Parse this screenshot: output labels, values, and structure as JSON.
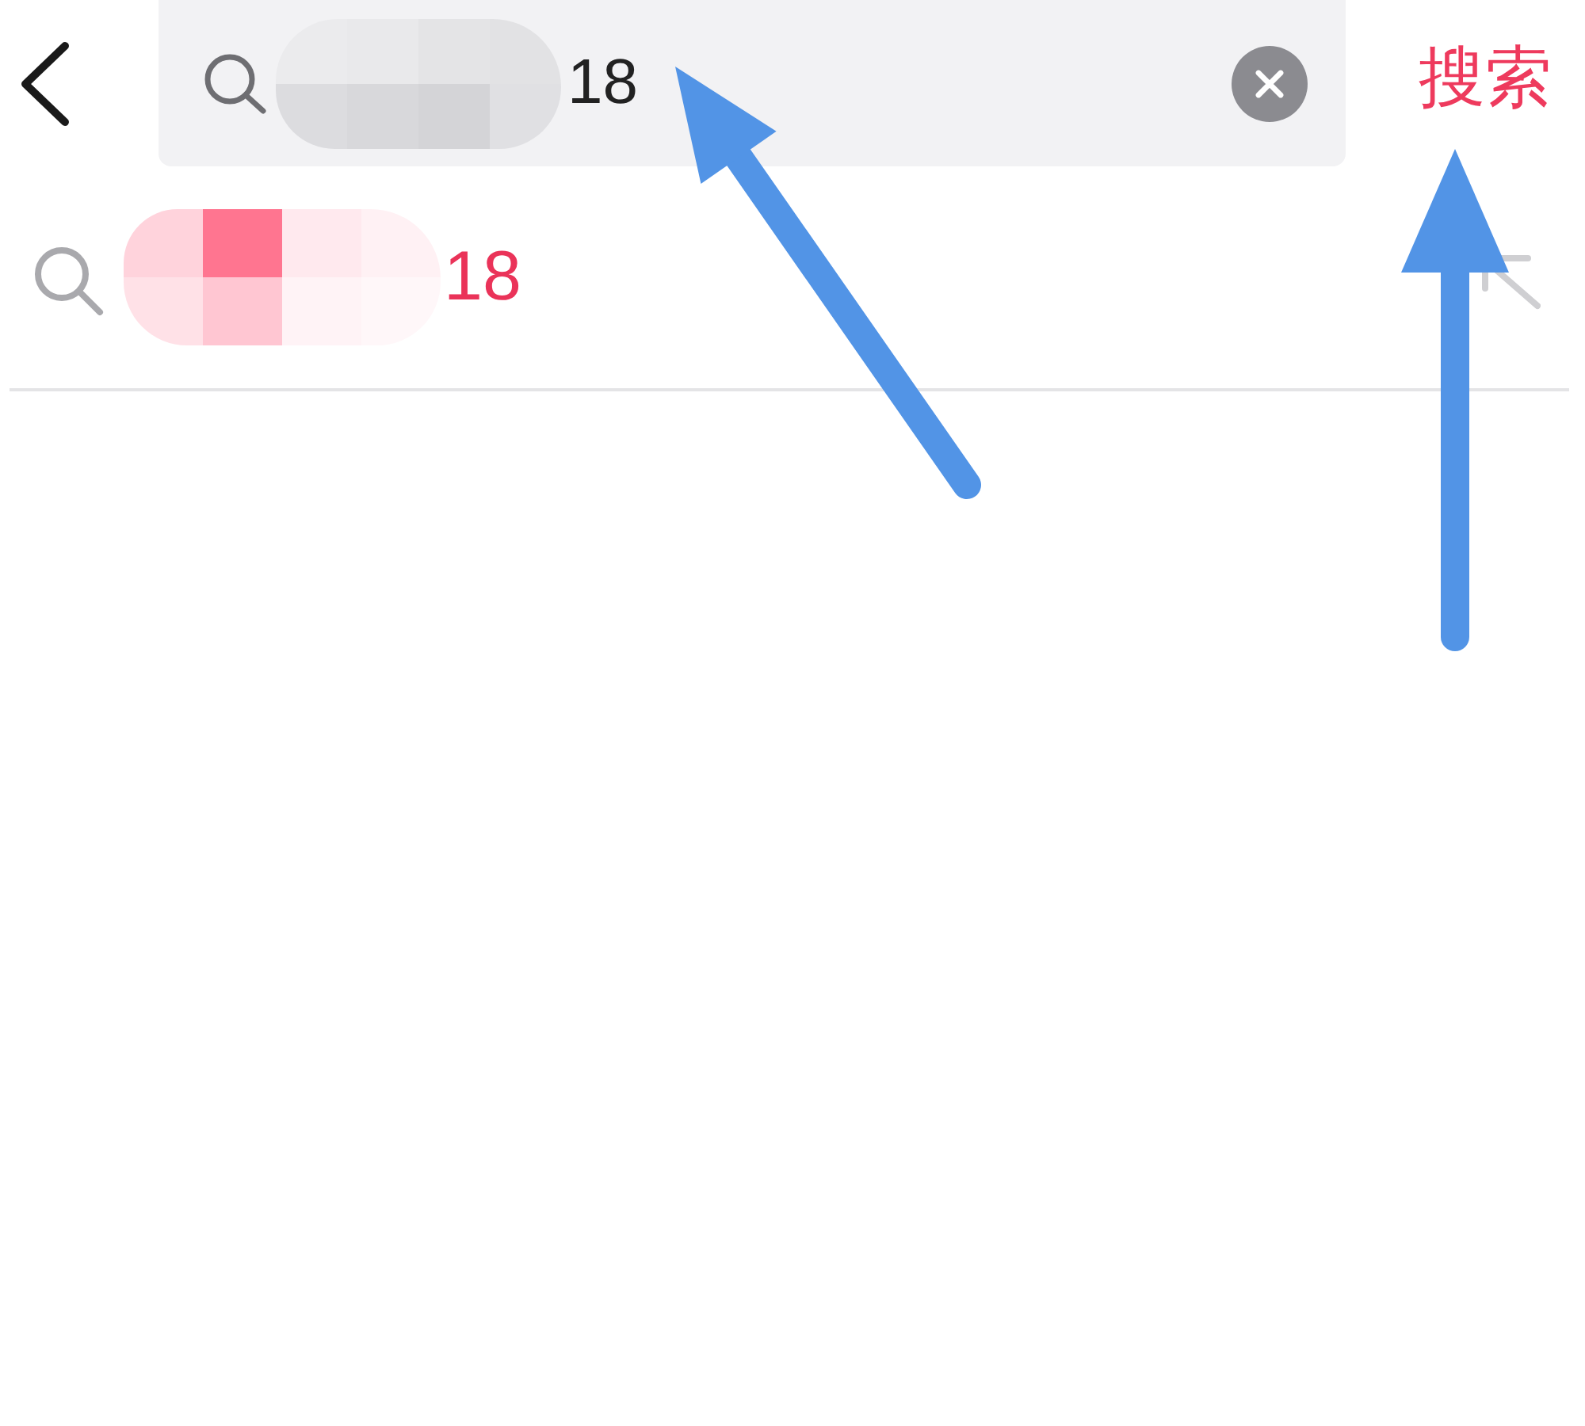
{
  "header": {
    "search_field": {
      "value": "18",
      "redacted": true
    },
    "search_button": {
      "label": "搜索"
    }
  },
  "suggestions": [
    {
      "text": "18",
      "redacted": true
    }
  ],
  "annotations": [
    {
      "kind": "arrow"
    },
    {
      "kind": "arrow"
    }
  ]
}
